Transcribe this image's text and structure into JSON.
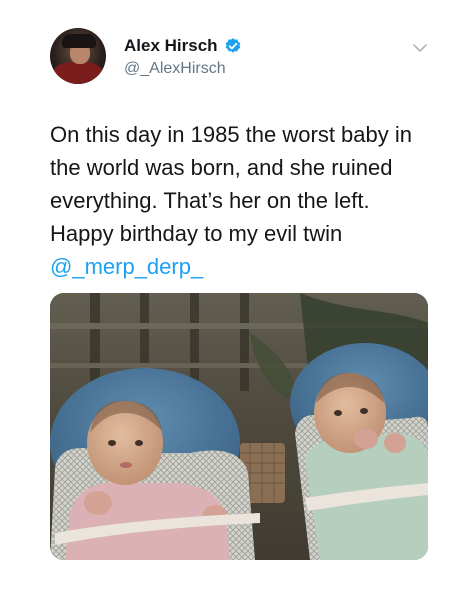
{
  "tweet": {
    "author": {
      "display_name": "Alex Hirsch",
      "handle": "@_AlexHirsch",
      "verified": true,
      "avatar_icon": "profile-photo"
    },
    "menu_icon": "chevron-down-icon",
    "text_lines": [
      "On this day in 1985 the worst baby in",
      "the world was born, and she ruined",
      "everything. That’s her on the left.",
      "Happy birthday to my evil twin"
    ],
    "mention": "@_merp_derp_",
    "media": {
      "type": "photo"
    }
  },
  "colors": {
    "link": "#1da1f2",
    "verified_badge": "#1da1f2",
    "secondary_text": "#657786",
    "primary_text": "#14171a"
  }
}
